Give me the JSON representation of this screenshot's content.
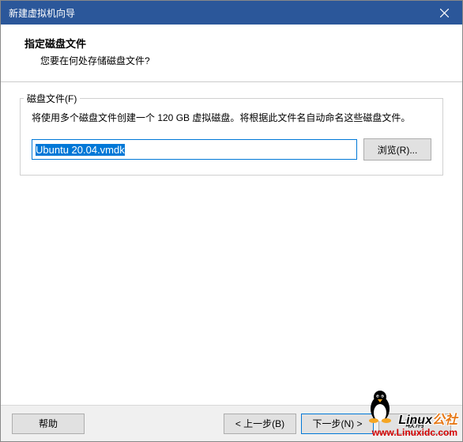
{
  "titlebar": {
    "title": "新建虚拟机向导"
  },
  "header": {
    "title": "指定磁盘文件",
    "subtitle": "您要在何处存储磁盘文件?"
  },
  "group": {
    "legend": "磁盘文件(F)",
    "description": "将使用多个磁盘文件创建一个 120 GB 虚拟磁盘。将根据此文件名自动命名这些磁盘文件。",
    "file_value": "Ubuntu 20.04.vmdk",
    "browse_label": "浏览(R)..."
  },
  "footer": {
    "help_label": "帮助",
    "back_label": "< 上一步(B)",
    "next_label": "下一步(N) >",
    "cancel_label": "取消"
  },
  "watermark": {
    "brand_part1": "Linux",
    "brand_part2": "公社",
    "url": "www.Linuxidc.com"
  }
}
